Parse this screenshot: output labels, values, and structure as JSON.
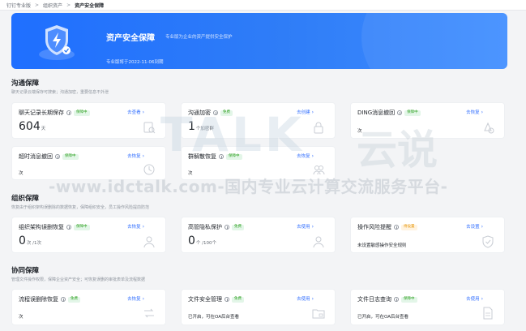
{
  "breadcrumb": {
    "items": [
      "钉钉专业版",
      "组织资产",
      "资产安全保障"
    ]
  },
  "banner": {
    "title": "资产安全保障",
    "subtitle": "专业版为企业的资产提供安全保护",
    "expire": "专业版将于2022-11-06到期"
  },
  "sections": [
    {
      "title": "沟通保障",
      "desc": "聊天记录云端保存可搜索；沟通加密，重要信息不外泄",
      "cards": [
        {
          "title": "聊天记录长期保存",
          "badge": "保障中",
          "badge_color": "green",
          "action": "去查看",
          "big": "604",
          "unit": "天",
          "text": ""
        },
        {
          "title": "沟通加密",
          "badge": "免费",
          "badge_color": "green",
          "action": "去创建",
          "big": "1",
          "unit": "个加密群",
          "text": ""
        },
        {
          "title": "DING消息撤回",
          "badge": "保障中",
          "badge_color": "green",
          "action": "去恢复",
          "big": "",
          "unit": "",
          "text": "次"
        },
        {
          "title": "超时消息撤回",
          "badge": "保障中",
          "badge_color": "green",
          "action": "去恢复",
          "big": "",
          "unit": "",
          "text": "次"
        },
        {
          "title": "群解散恢复",
          "badge": "保障中",
          "badge_color": "green",
          "action": "去恢复",
          "big": "",
          "unit": "",
          "text": "次"
        }
      ]
    },
    {
      "title": "组织保障",
      "desc": "恢复由于组织架构误删除的数据恢复，保障组织安全，员工操作风险提前防范",
      "cards": [
        {
          "title": "组织架构误删恢复",
          "badge": "保障中",
          "badge_color": "green",
          "action": "去恢复",
          "big": "0",
          "unit": "次 /1次",
          "text": ""
        },
        {
          "title": "高管隐私保护",
          "badge": "免费",
          "badge_color": "green",
          "action": "去使用",
          "big": "0",
          "unit": "个 /100个",
          "text": ""
        },
        {
          "title": "操作风险提醒",
          "badge": "待设置",
          "badge_color": "orange",
          "action": "去设置",
          "big": "",
          "unit": "",
          "text": "未设置敏感操作安全规则"
        }
      ]
    },
    {
      "title": "协同保障",
      "desc": "管理文件操作权限，保障企业资产安全；可恢复误删的审批表单及流程数据",
      "cards": [
        {
          "title": "流程误删除恢复",
          "badge": "免费",
          "badge_color": "green",
          "action": "去恢复",
          "big": "",
          "unit": "",
          "text": "次"
        },
        {
          "title": "文件安全管理",
          "badge": "免费",
          "badge_color": "green",
          "action": "去使用",
          "big": "",
          "unit": "",
          "text": "已开启，可在OA后台查看"
        },
        {
          "title": "文件日志查询",
          "badge": "保障中",
          "badge_color": "green",
          "action": "去使用",
          "big": "",
          "unit": "",
          "text": "已开启，可在OA后台查看"
        }
      ]
    }
  ],
  "watermark": {
    "logo": "TALK",
    "cn": "云说",
    "url": "-www.idctalk.com-国内专业云计算交流服务平台-"
  },
  "colors": {
    "accent": "#3370ff",
    "banner": "#2f7df7",
    "badge_green": "#2ea121",
    "badge_orange": "#e69300"
  }
}
